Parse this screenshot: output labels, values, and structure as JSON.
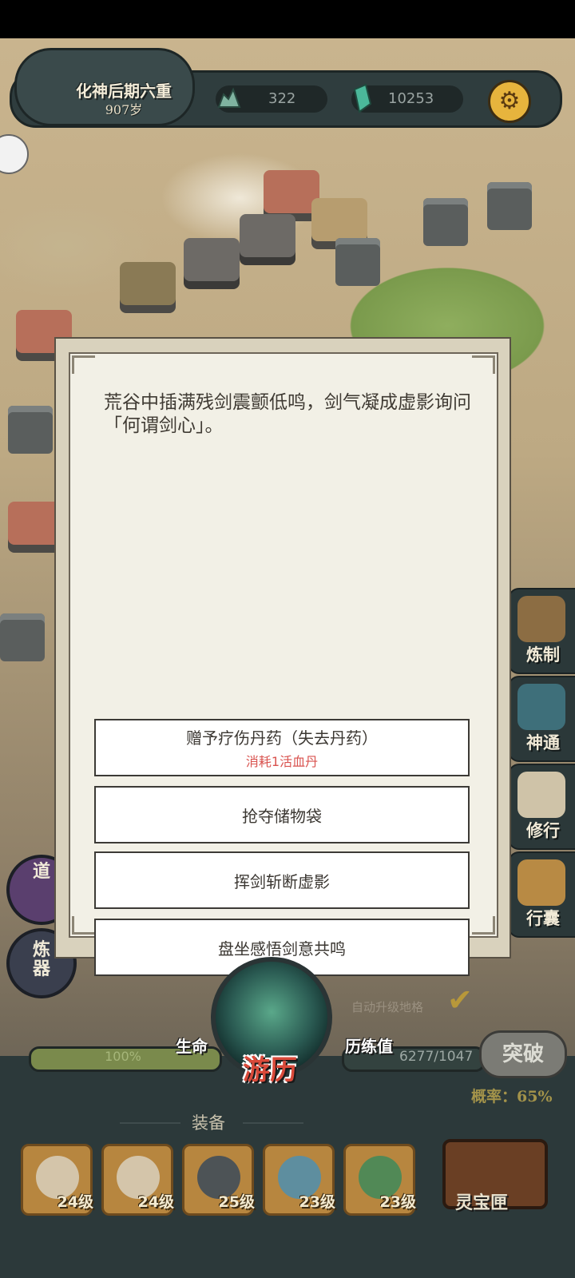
{
  "status": {
    "realm": "化神后期六重",
    "age": "907岁",
    "stone_count": "322",
    "crystal_count": "10253"
  },
  "dialog": {
    "text": "荒谷中插满残剑震颤低鸣，剑气凝成虚影询问「何谓剑心」。",
    "choices": [
      {
        "label": "赠予疗伤丹药（失去丹药）",
        "cost": "消耗1活血丹"
      },
      {
        "label": "抢夺储物袋"
      },
      {
        "label": "挥剑斩断虚影"
      },
      {
        "label": "盘坐感悟剑意共鸣"
      }
    ]
  },
  "side_menu": {
    "craft": "炼制",
    "powers": "神通",
    "practice": "修行",
    "bag": "行囊"
  },
  "left_buttons": {
    "dao": "道",
    "refiner": "炼器"
  },
  "auto_upgrade": "自动升级地格",
  "life": {
    "label": "生命",
    "value": "100%",
    "fraction": 1.0
  },
  "experience": {
    "label": "历练值",
    "value": "6277/1047"
  },
  "travel_label": "游历",
  "breakthrough": "突破",
  "probability": "概率：65%",
  "equipment": {
    "title": "装备",
    "slots": [
      {
        "icon": "sword-icon",
        "level": "24级"
      },
      {
        "icon": "robe-icon",
        "level": "24级"
      },
      {
        "icon": "belt-icon",
        "level": "25级"
      },
      {
        "icon": "ring-icon",
        "level": "23级"
      },
      {
        "icon": "jade-icon",
        "level": "23级"
      }
    ]
  },
  "treasure_box": "灵宝匣"
}
